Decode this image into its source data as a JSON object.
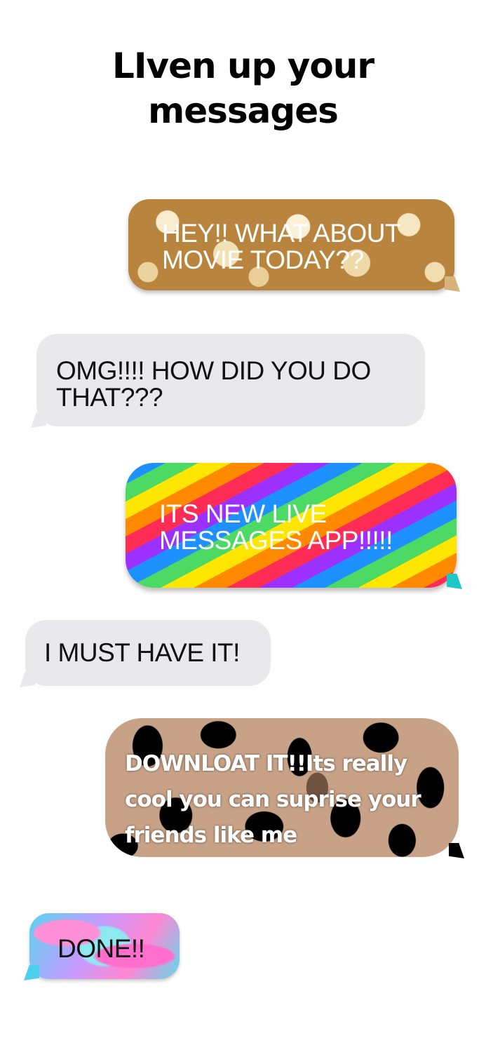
{
  "header": {
    "title_line1": "LIven up your",
    "title_line2": "messages"
  },
  "messages": [
    {
      "side": "right",
      "style": "popcorn",
      "lines": [
        "HEY!! WHAT ABOUT",
        "MOVIE TODAY??"
      ]
    },
    {
      "side": "left",
      "style": "gray",
      "lines": [
        "OMG!!!! HOW DID YOU DO",
        "THAT???"
      ]
    },
    {
      "side": "right",
      "style": "rainbow",
      "lines": [
        "ITS NEW LIVE",
        "MESSAGES APP!!!!!"
      ]
    },
    {
      "side": "left",
      "style": "gray",
      "lines": [
        "I MUST HAVE IT!"
      ]
    },
    {
      "side": "right",
      "style": "leopard",
      "lines": [
        "DOWNLOAT IT!!Its really",
        "cool you can suprise your",
        "friends like me"
      ]
    },
    {
      "side": "left",
      "style": "marble",
      "lines": [
        "DONE!!"
      ]
    }
  ],
  "colors": {
    "gray_bubble": "#e9e9eb",
    "title_text": "#000000"
  }
}
